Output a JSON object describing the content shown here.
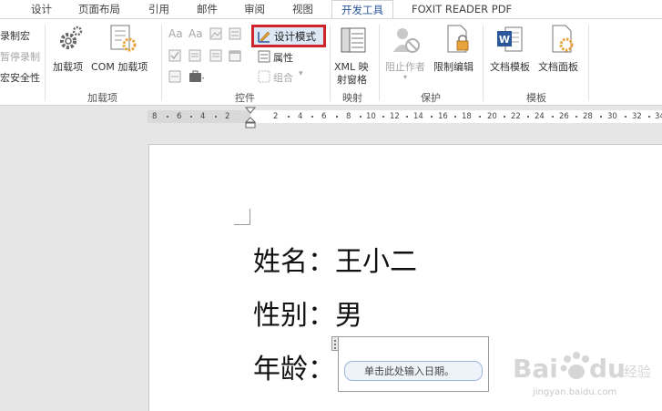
{
  "tabs": [
    {
      "label": "设计",
      "active": false
    },
    {
      "label": "页面布局",
      "active": false
    },
    {
      "label": "引用",
      "active": false
    },
    {
      "label": "邮件",
      "active": false
    },
    {
      "label": "审阅",
      "active": false
    },
    {
      "label": "视图",
      "active": false
    },
    {
      "label": "开发工具",
      "active": true
    },
    {
      "label": "FOXIT READER PDF",
      "active": false
    }
  ],
  "ribbon": {
    "code": {
      "record_macro": "录制宏",
      "pause_recording": "暂停录制",
      "macro_security": "宏安全性"
    },
    "addins": {
      "addins_label": "加载项",
      "com_label": "COM 加载项",
      "group_label": "加载项"
    },
    "controls": {
      "design_mode": "设计模式",
      "properties": "属性",
      "group_combo": "组合",
      "group_label": "控件"
    },
    "mapping": {
      "xml_line1": "XML 映",
      "xml_line2": "射窗格",
      "group_label": "映射"
    },
    "protect": {
      "block_authors": "阻止作者",
      "restrict_editing": "限制编辑",
      "group_label": "保护"
    },
    "templates": {
      "document_template": "文档模板",
      "document_panel": "文档面板",
      "group_label": "模板"
    }
  },
  "ruler": {
    "numbers": [
      "8",
      "6",
      "4",
      "2",
      "2",
      "4",
      "6",
      "8",
      "10",
      "12",
      "14",
      "16",
      "18",
      "20",
      "22",
      "24",
      "26",
      "28",
      "30",
      "32",
      "34"
    ]
  },
  "document": {
    "line1": "姓名：王小二",
    "line2": "性别：男",
    "line3": "年龄：",
    "date_placeholder": "单击此处输入日期。"
  },
  "watermark": {
    "url": "jingyan.baidu.com"
  },
  "colors": {
    "accent": "#2b579a",
    "highlight_border": "#d0232a",
    "word_blue": "#2b579a",
    "gear_orange": "#e8a33d"
  }
}
